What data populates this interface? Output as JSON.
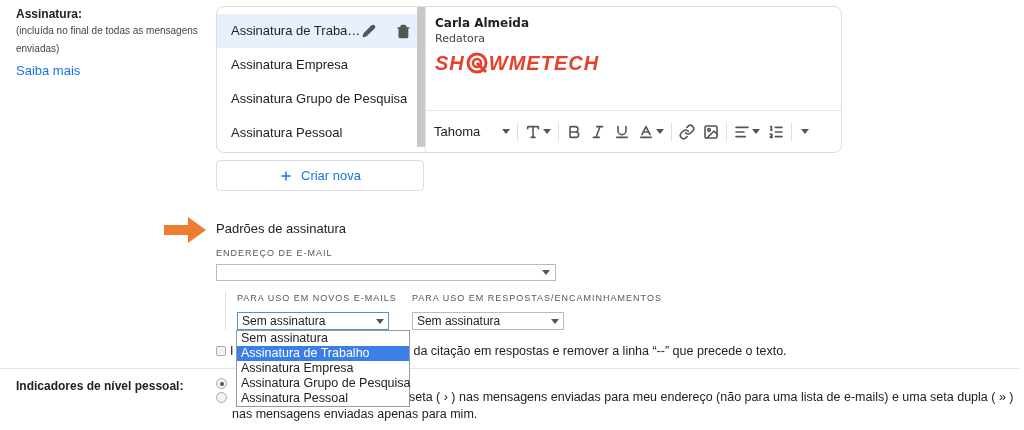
{
  "section_label": "Assinatura:",
  "section_note": "(incluída no final de todas as mensagens enviadas)",
  "learn_more": "Saiba mais",
  "signatures": [
    {
      "name": "Assinatura de Traba…",
      "selected": true
    },
    {
      "name": "Assinatura Empresa",
      "selected": false
    },
    {
      "name": "Assinatura Grupo de Pesquisa",
      "selected": false
    },
    {
      "name": "Assinatura Pessoal",
      "selected": false
    }
  ],
  "create_button": "Criar nova",
  "editor": {
    "name": "Carla Almeida",
    "role": "Redatora",
    "logo_start": "SH",
    "logo_end": "WMETECH"
  },
  "toolbar": {
    "font": "Tahoma"
  },
  "defaults": {
    "title": "Padrões de assinatura",
    "email_label": "ENDEREÇO DE E-MAIL",
    "new_label": "PARA USO EM NOVOS E-MAILS",
    "new_value": "Sem assinatura",
    "reply_label": "PARA USO EM RESPOSTAS/ENCAMINHAMENTOS",
    "reply_value": "Sem assinatura",
    "options": [
      {
        "label": "Sem assinatura",
        "selected": false
      },
      {
        "label": "Assinatura de Trabalho",
        "selected": true
      },
      {
        "label": "Assinatura Empresa",
        "selected": false
      },
      {
        "label": "Assinatura Grupo de Pesquisa",
        "selected": false
      },
      {
        "label": "Assinatura Pessoal",
        "selected": false
      }
    ]
  },
  "insert_before_quote": {
    "checked": false,
    "label_start": "I",
    "label_end": "da citação em respostas e remover a linha “--” que precede o texto."
  },
  "personal_indicators": {
    "label": "Indicadores de nível pessoal:",
    "options": [
      {
        "selected": true
      },
      {
        "selected": false,
        "rest": "seta ( › ) nas mensagens enviadas para meu endereço (não para uma lista de e-mails) e uma seta dupla ( » )",
        "line2": "nas mensagens enviadas apenas para mim."
      }
    ]
  }
}
